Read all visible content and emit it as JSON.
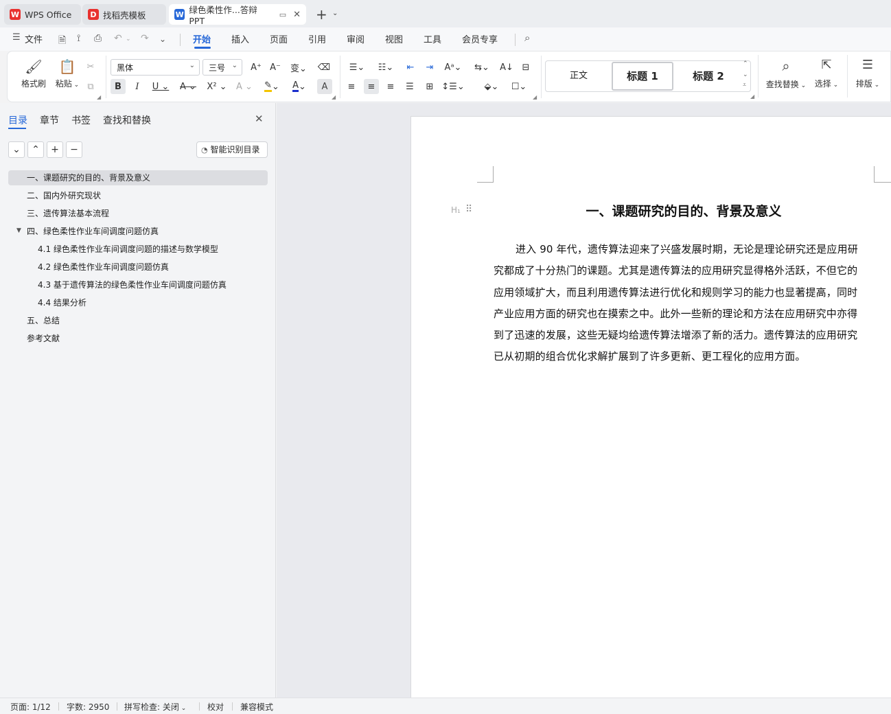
{
  "tabs": [
    {
      "label": "WPS Office"
    },
    {
      "label": "找稻壳模板"
    },
    {
      "label": "绿色柔性作...答辩PPT"
    }
  ],
  "menu": {
    "file": "文件",
    "items": [
      "开始",
      "插入",
      "页面",
      "引用",
      "审阅",
      "视图",
      "工具",
      "会员专享"
    ]
  },
  "ribbon": {
    "format_painter": "格式刷",
    "paste": "粘贴",
    "font_name": "黑体",
    "font_size": "三号",
    "styles": [
      "正文",
      "标题 1",
      "标题 2"
    ],
    "find_replace": "查找替换",
    "select": "选择",
    "layout": "排版"
  },
  "nav": {
    "tabs": [
      "目录",
      "章节",
      "书签",
      "查找和替换"
    ],
    "smart_toc": "智能识别目录",
    "toc": [
      {
        "label": "一、课题研究的目的、背景及意义"
      },
      {
        "label": "二、国内外研究现状"
      },
      {
        "label": "三、遗传算法基本流程"
      },
      {
        "label": "四、绿色柔性作业车间调度问题仿真"
      },
      {
        "label": "4.1 绿色柔性作业车间调度问题的描述与数学模型"
      },
      {
        "label": "4.2 绿色柔性作业车间调度问题仿真"
      },
      {
        "label": "4.3 基于遗传算法的绿色柔性作业车间调度问题仿真"
      },
      {
        "label": "4.4 结果分析"
      },
      {
        "label": "五、总结"
      },
      {
        "label": "参考文献"
      }
    ]
  },
  "document": {
    "heading": "一、课题研究的目的、背景及意义",
    "lines": [
      "进入 90 年代，遗传算法迎来了兴盛发展时期，无论是理论研究还是应用研",
      "究都成了十分热门的课题。尤其是遗传算法的应用研究显得格外活跃，不但它的",
      "应用领域扩大，而且利用遗传算法进行优化和规则学习的能力也显著提高，同时",
      "产业应用方面的研究也在摸索之中。此外一些新的理论和方法在应用研究中亦得",
      "到了迅速的发展，这些无疑均给遗传算法增添了新的活力。遗传算法的应用研究",
      "已从初期的组合优化求解扩展到了许多更新、更工程化的应用方面。"
    ]
  },
  "status": {
    "page": "页面: 1/12",
    "words": "字数: 2950",
    "spell": "拼写检查: 关闭",
    "proof": "校对",
    "compat": "兼容模式"
  },
  "colors": {
    "accent": "#2768d8",
    "wps_red": "#e8312f"
  }
}
